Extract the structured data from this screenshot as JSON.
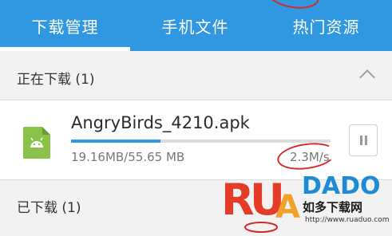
{
  "tabs": [
    {
      "label": "下载管理",
      "active": true
    },
    {
      "label": "手机文件",
      "active": false
    },
    {
      "label": "热门资源",
      "active": false
    }
  ],
  "downloading_section": {
    "title": "正在下载 (1)",
    "expanded": true
  },
  "download_item": {
    "file_name": "AngryBirds_4210.apk",
    "size_progress": "19.16MB/55.65 MB",
    "speed": "2.3M/s",
    "progress_fraction": 0.344
  },
  "downloaded_section": {
    "title": "已下载 (1)"
  },
  "watermark": {
    "logo_text": "RUADADO",
    "chinese_name": "如多下载网",
    "url": "http://www.ruaduo.com"
  },
  "colors": {
    "accent": "#2f98e0",
    "apk_icon": "#8bc34a",
    "annotation_red": "#d12a2a"
  },
  "icons": [
    "android-apk-icon",
    "chevron-up-icon",
    "pause-icon"
  ]
}
